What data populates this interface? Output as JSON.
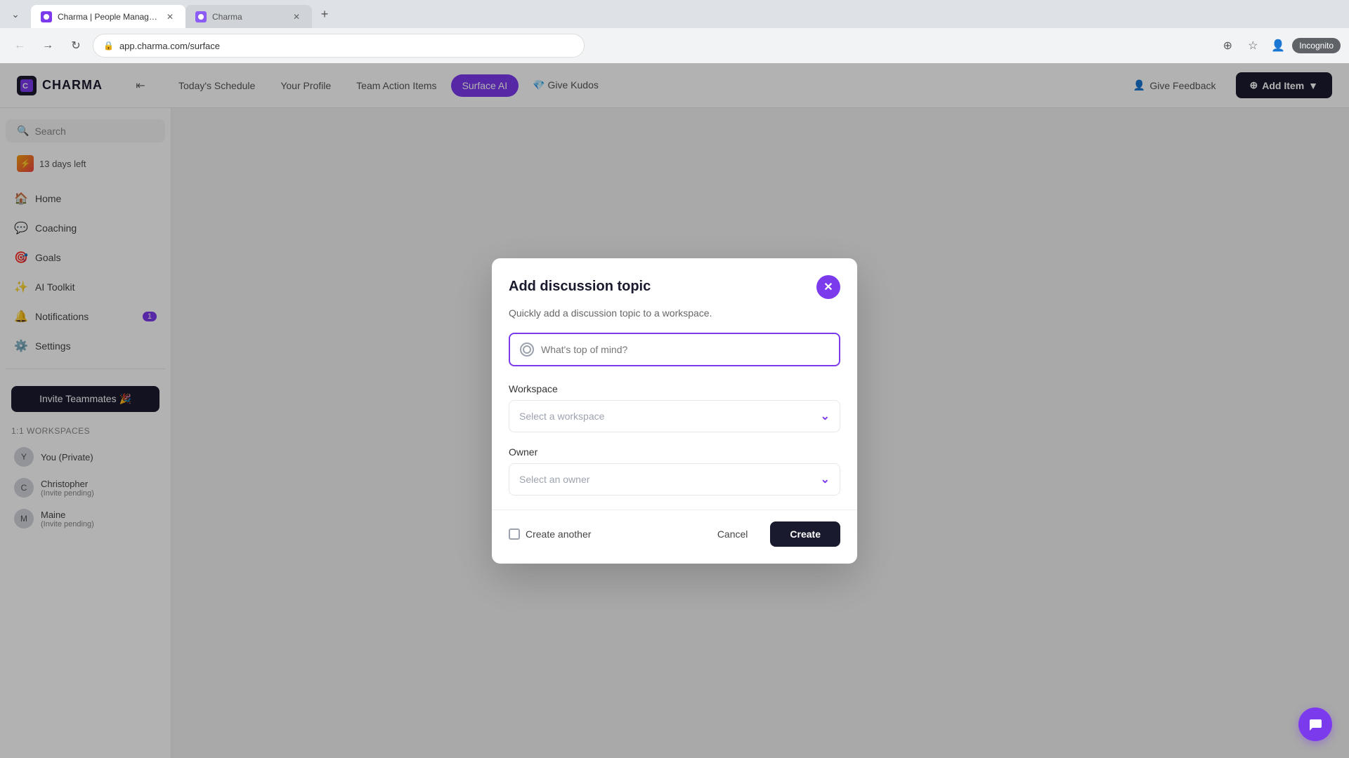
{
  "browser": {
    "tabs": [
      {
        "id": "tab1",
        "title": "Charma | People Management ...",
        "favicon_color": "#7c3aed",
        "active": true
      },
      {
        "id": "tab2",
        "title": "Charma",
        "favicon_color": "#8b5cf6",
        "active": false
      }
    ],
    "address": "app.charma.com/surface",
    "incognito_label": "Incognito"
  },
  "topnav": {
    "logo_text": "CHARMA",
    "links": [
      {
        "id": "todays-schedule",
        "label": "Today's Schedule",
        "active": false
      },
      {
        "id": "your-profile",
        "label": "Your Profile",
        "active": false
      },
      {
        "id": "team-action-items",
        "label": "Team Action Items",
        "active": false
      },
      {
        "id": "surface-ai",
        "label": "Surface AI",
        "active": true
      },
      {
        "id": "give-kudos",
        "label": "Give Kudos",
        "active": false
      }
    ],
    "give_feedback_label": "Give Feedback",
    "add_item_label": "Add Item"
  },
  "sidebar": {
    "search_placeholder": "Search",
    "trial_text": "13 days left",
    "nav_items": [
      {
        "id": "home",
        "icon": "🏠",
        "label": "Home",
        "badge": null
      },
      {
        "id": "coaching",
        "icon": "💬",
        "label": "Coaching",
        "badge": null
      },
      {
        "id": "goals",
        "icon": "🎯",
        "label": "Goals",
        "badge": null
      },
      {
        "id": "ai-toolkit",
        "icon": "✨",
        "label": "AI Toolkit",
        "badge": null
      },
      {
        "id": "notifications",
        "icon": "🔔",
        "label": "Notifications",
        "badge": "1"
      },
      {
        "id": "settings",
        "icon": "⚙️",
        "label": "Settings",
        "badge": null
      }
    ],
    "invite_label": "Invite Teammates 🎉",
    "workspaces_label": "1:1 Workspaces",
    "workspace_items": [
      {
        "id": "you-private",
        "name": "You (Private)",
        "sub": null
      },
      {
        "id": "christopher",
        "name": "Christopher",
        "sub": "(Invite pending)"
      },
      {
        "id": "maine",
        "name": "Maine",
        "sub": "(Invite pending)"
      }
    ]
  },
  "modal": {
    "title": "Add discussion topic",
    "subtitle": "Quickly add a discussion topic to a workspace.",
    "topic_placeholder": "What's top of mind?",
    "workspace_label": "Workspace",
    "workspace_placeholder": "Select a workspace",
    "owner_label": "Owner",
    "owner_placeholder": "Select an owner",
    "create_another_label": "Create another",
    "cancel_label": "Cancel",
    "create_label": "Create"
  }
}
